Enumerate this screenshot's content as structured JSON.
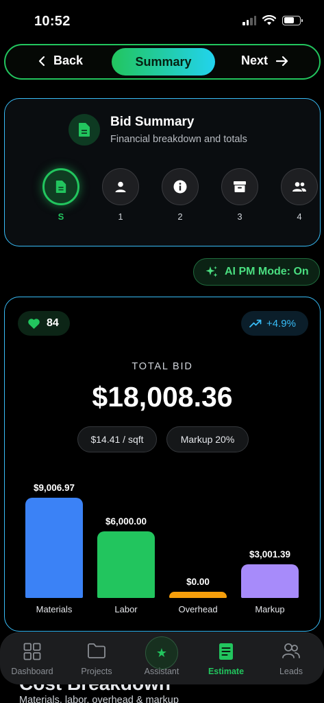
{
  "status_bar": {
    "time": "10:52"
  },
  "step_nav": {
    "back_label": "Back",
    "current_label": "Summary",
    "next_label": "Next"
  },
  "header": {
    "title": "Bid Summary",
    "subtitle": "Financial breakdown and totals",
    "steps": [
      {
        "label": "S",
        "icon": "document-icon",
        "active": true
      },
      {
        "label": "1",
        "icon": "user-icon"
      },
      {
        "label": "2",
        "icon": "info-icon"
      },
      {
        "label": "3",
        "icon": "archive-icon"
      },
      {
        "label": "4",
        "icon": "users-icon"
      }
    ]
  },
  "ai_mode": {
    "label": "AI PM Mode: On",
    "icon": "sparkles-icon"
  },
  "bid": {
    "score": "84",
    "trend": "+4.9%",
    "total_label": "TOTAL BID",
    "total_value": "$18,008.36",
    "chips": [
      "$14.41 / sqft",
      "Markup 20%"
    ]
  },
  "chart_data": {
    "type": "bar",
    "categories": [
      "Materials",
      "Labor",
      "Overhead",
      "Markup"
    ],
    "values": [
      9006.97,
      6000.0,
      0.0,
      3001.39
    ],
    "value_labels": [
      "$9,006.97",
      "$6,000.00",
      "$0.00",
      "$3,001.39"
    ],
    "colors": [
      "#3b82f6",
      "#22c55e",
      "#f59e0b",
      "#a78bfa"
    ],
    "grid": false
  },
  "cost_breakdown": {
    "title": "Cost Breakdown",
    "subtitle": "Materials, labor, overhead & markup"
  },
  "tab_bar": {
    "tabs": [
      {
        "label": "Dashboard",
        "icon": "grid-icon"
      },
      {
        "label": "Projects",
        "icon": "folder-icon"
      },
      {
        "label": "Assistant",
        "icon": "star-icon"
      },
      {
        "label": "Estimate",
        "icon": "document-icon",
        "active": true
      },
      {
        "label": "Leads",
        "icon": "users-icon"
      }
    ]
  }
}
